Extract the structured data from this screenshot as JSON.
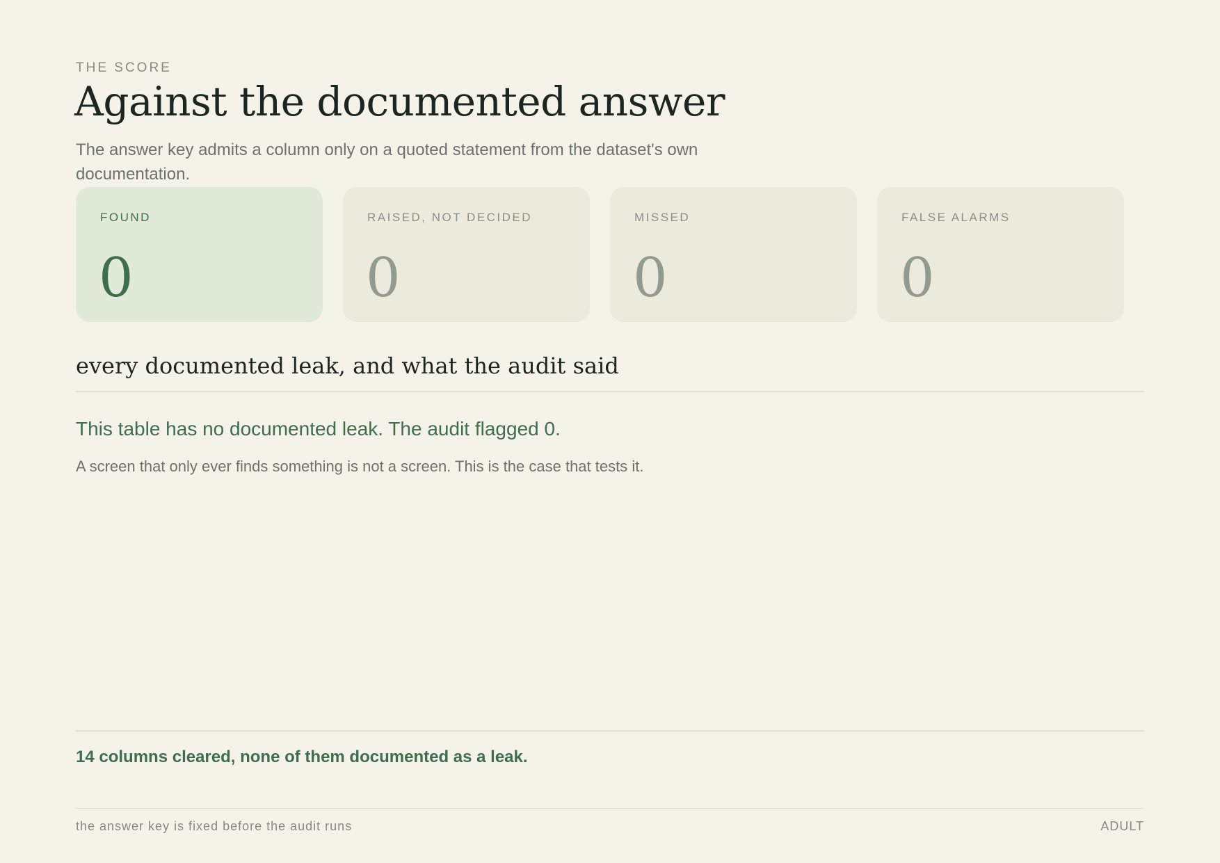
{
  "header": {
    "eyebrow": "THE SCORE",
    "title": "Against the documented answer",
    "subtitle": "The answer key admits a column only on a quoted statement from the dataset's own documentation."
  },
  "cards": [
    {
      "label": "FOUND",
      "value": "0"
    },
    {
      "label": "RAISED, NOT DECIDED",
      "value": "0"
    },
    {
      "label": "MISSED",
      "value": "0"
    },
    {
      "label": "FALSE ALARMS",
      "value": "0"
    }
  ],
  "section": {
    "heading": "every documented leak, and what the audit said",
    "headline": "This table has no documented leak. The audit flagged 0.",
    "note": "A screen that only ever finds something is not a screen. This is the case that tests it."
  },
  "summary": "14 columns cleared, none of them documented as a leak.",
  "footer": {
    "left": "the answer key is fixed before the audit runs",
    "right": "ADULT"
  },
  "colors": {
    "background": "#f5f2ea",
    "accent_green": "#3f6e4c",
    "found_card": "#e1e9d8",
    "neutral_card": "#ece9dd"
  }
}
